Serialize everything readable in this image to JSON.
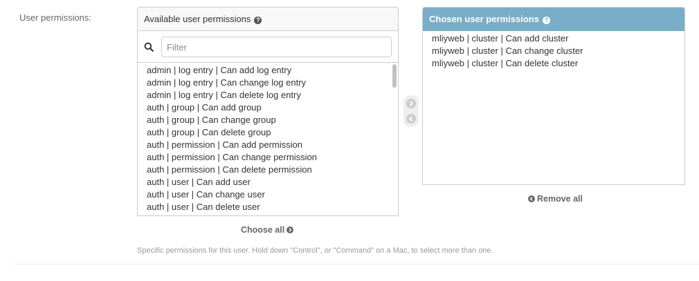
{
  "field": {
    "label": "User permissions:"
  },
  "available": {
    "title": "Available user permissions",
    "help_glyph": "?",
    "filter_placeholder": "Filter",
    "filter_value": "",
    "options": [
      "admin | log entry | Can add log entry",
      "admin | log entry | Can change log entry",
      "admin | log entry | Can delete log entry",
      "auth | group | Can add group",
      "auth | group | Can change group",
      "auth | group | Can delete group",
      "auth | permission | Can add permission",
      "auth | permission | Can change permission",
      "auth | permission | Can delete permission",
      "auth | user | Can add user",
      "auth | user | Can change user",
      "auth | user | Can delete user"
    ],
    "choose_all_label": "Choose all"
  },
  "chosen": {
    "title": "Chosen user permissions",
    "help_glyph": "?",
    "options": [
      "mliyweb | cluster | Can add cluster",
      "mliyweb | cluster | Can change cluster",
      "mliyweb | cluster | Can delete cluster"
    ],
    "remove_all_label": "Remove all"
  },
  "help_text": "Specific permissions for this user. Hold down \"Control\", or \"Command\" on a Mac, to select more than one.",
  "icons": {
    "search": "search-icon",
    "choose": "arrow-right-circle-icon",
    "remove": "arrow-left-circle-icon",
    "help": "question-circle-icon"
  },
  "colors": {
    "chosen_header": "#79aec8",
    "arrow_inactive": "#cccccc",
    "link": "#666666"
  }
}
